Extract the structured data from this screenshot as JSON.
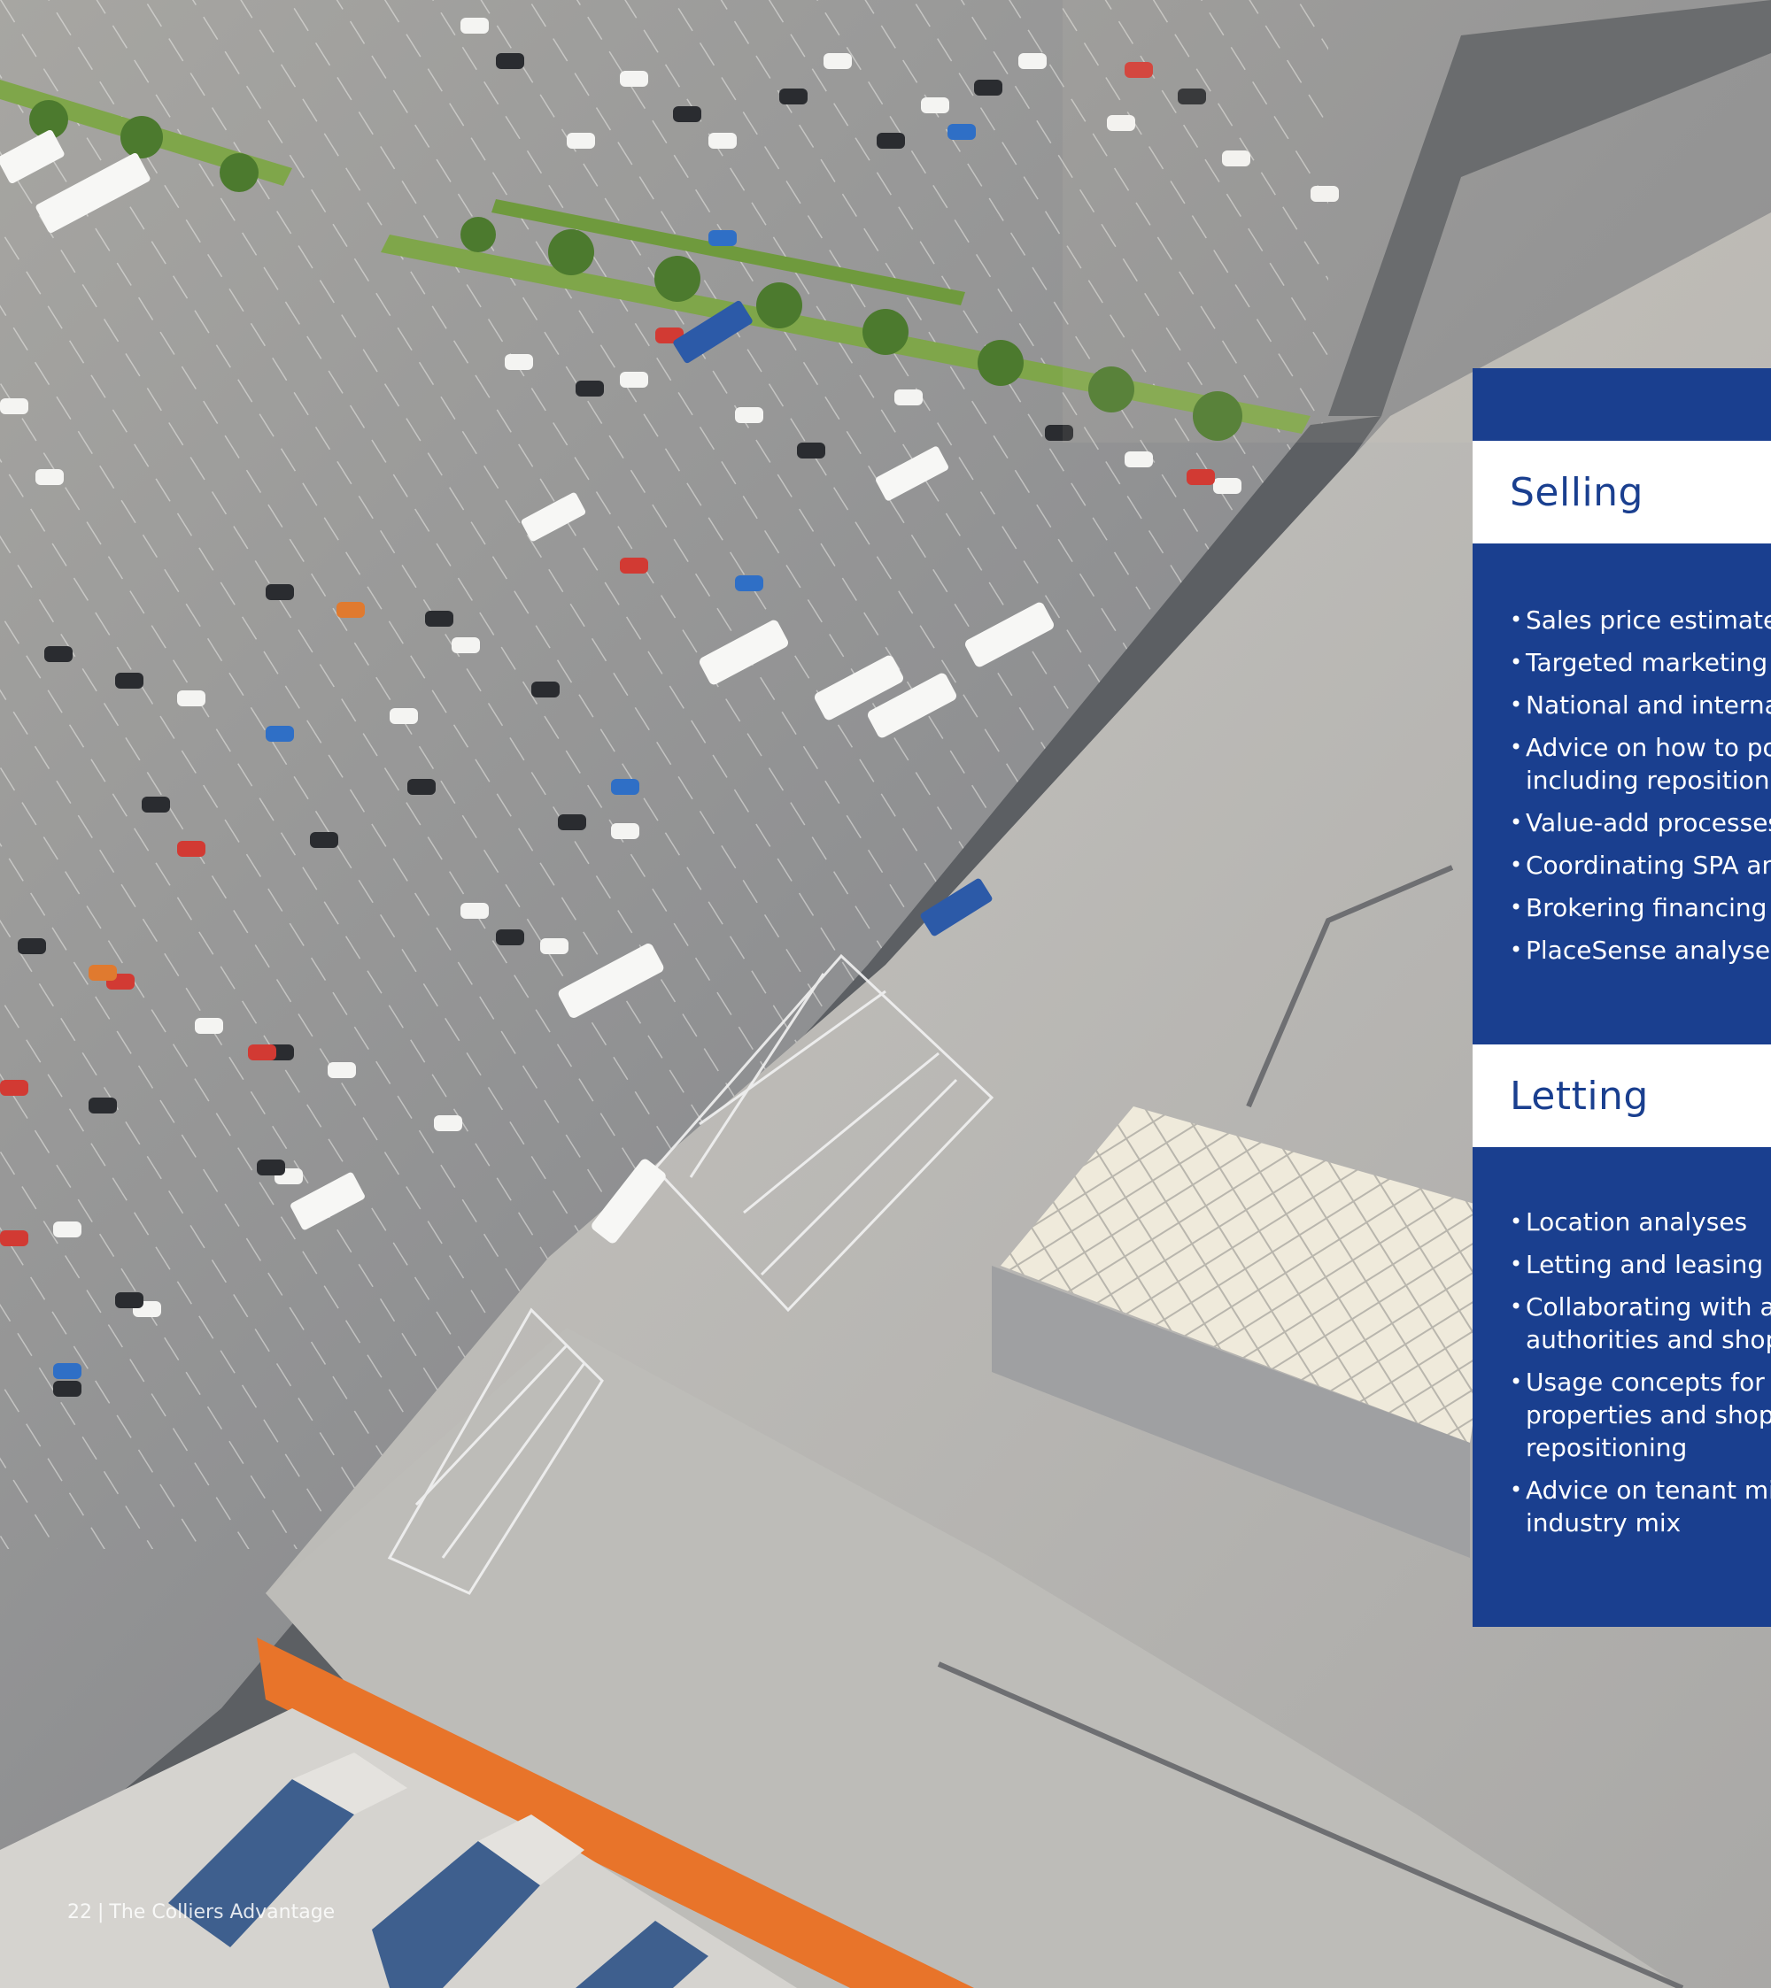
{
  "page": {
    "footer": {
      "page_number": "22",
      "separator": "|",
      "title": "The Colliers Advantage"
    }
  },
  "colors": {
    "brand_navy": "#1a3f8f",
    "heading_bg": "#ffffff",
    "highlight_orange": "#e8742a"
  },
  "selling": {
    "heading": "Selling",
    "items": [
      [
        "Sales price estimates"
      ],
      [
        "Targeted marketing"
      ],
      [
        "National and interna"
      ],
      [
        "Advice on how to po",
        "including repositioni"
      ],
      [
        "Value-add processes"
      ],
      [
        "Coordinating SPA an"
      ],
      [
        "Brokering financing"
      ],
      [
        "PlaceSense analyses"
      ]
    ]
  },
  "letting": {
    "heading": "Letting",
    "items": [
      [
        "Location analyses"
      ],
      [
        "Letting and leasing r"
      ],
      [
        "Collaborating with a",
        "authorities and shop"
      ],
      [
        "Usage concepts for r",
        "properties and shop",
        "repositioning"
      ],
      [
        "Advice on tenant mix",
        "industry mix"
      ]
    ]
  }
}
